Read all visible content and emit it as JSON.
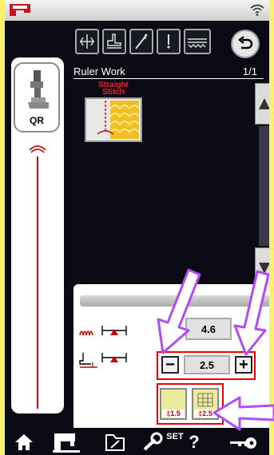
{
  "pattern": {
    "title": "Ruler Work",
    "page": "1/1"
  },
  "stitch": {
    "label_line1": "Straight",
    "label_line2": "Stitch"
  },
  "foot": {
    "code": "QR"
  },
  "settings": {
    "row1_value": "4.6",
    "row2_value": "2.5",
    "minus_symbol": "−",
    "plus_symbol": "+"
  },
  "presets": [
    {
      "label": "‡1.5"
    },
    {
      "label": "‡2.5"
    }
  ],
  "toolbar": {
    "set_label": "SET",
    "help_label": "?"
  },
  "colors": {
    "accent_red": "#e00000",
    "annotation_purple": "#b24bf3",
    "background": "#f7f26a",
    "screen": "#0a0a14"
  }
}
